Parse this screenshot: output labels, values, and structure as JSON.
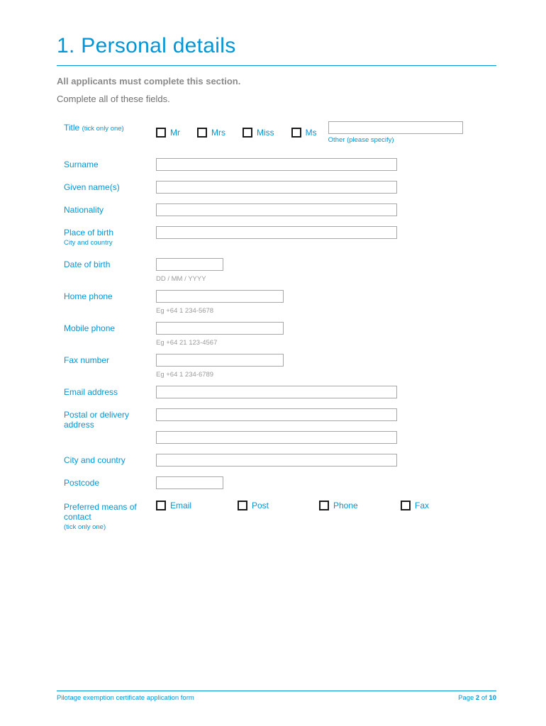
{
  "heading": "1.   Personal details",
  "instruction_bold": "All applicants must complete this section.",
  "instruction_sub": "Complete all of these fields.",
  "labels": {
    "title": "Title",
    "title_tick": "(tick only one)",
    "surname": "Surname",
    "given": "Given name(s)",
    "nationality": "Nationality",
    "pob": "Place of birth",
    "pob_sub": "City and country",
    "dob": "Date of birth",
    "home_phone": "Home phone",
    "mobile_phone": "Mobile phone",
    "fax": "Fax number",
    "email": "Email address",
    "postal": "Postal or delivery address",
    "city": "City and country",
    "postcode": "Postcode",
    "contact": "Preferred means of contact",
    "contact_tick": "(tick only one)"
  },
  "title_options": {
    "mr": "Mr",
    "mrs": "Mrs",
    "miss": "Miss",
    "ms": "Ms",
    "other_hint": "Other (please specify)"
  },
  "hints": {
    "dob": "DD / MM /  YYYY",
    "home": "Eg +64 1 234-5678",
    "mobile": "Eg +64 21 123-4567",
    "fax": "Eg +64 1 234-6789"
  },
  "contact_options": {
    "email": "Email",
    "post": "Post",
    "phone": "Phone",
    "fax": "Fax"
  },
  "footer": {
    "left": "Pilotage exemption certificate application form",
    "page_word": "Page",
    "page_num": "2",
    "page_of": "of",
    "page_total": "10"
  }
}
